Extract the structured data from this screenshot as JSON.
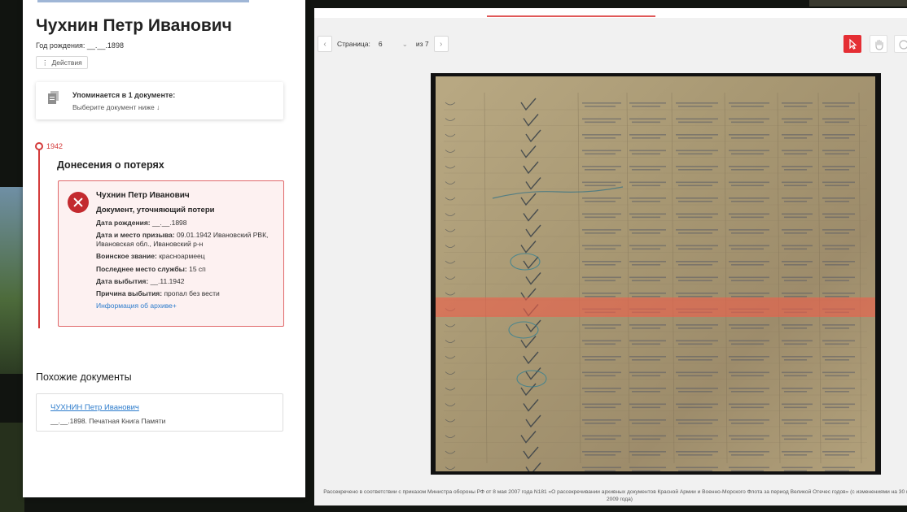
{
  "person": {
    "name": "Чухнин Петр Иванович",
    "birth_label": "Год рождения:",
    "birth_value": "__.__.1898"
  },
  "actions": {
    "label": "Действия"
  },
  "mentions": {
    "title": "Упоминается в 1 документе:",
    "subtitle": "Выберите документ ниже ↓"
  },
  "timeline": {
    "year": "1942",
    "section_title": "Донесения о потерях"
  },
  "loss_card": {
    "name": "Чухнин Петр Иванович",
    "doc_type": "Документ, уточняющий потери",
    "rows": [
      {
        "label": "Дата рождения:",
        "value": " __.__.1898"
      },
      {
        "label": "Дата и место призыва:",
        "value": " 09.01.1942 Ивановский РВК, Ивановская обл., Ивановский р-н"
      },
      {
        "label": "Воинское звание:",
        "value": " красноармеец"
      },
      {
        "label": "Последнее место службы:",
        "value": " 15 сп"
      },
      {
        "label": "Дата выбытия:",
        "value": " __.11.1942"
      },
      {
        "label": "Причина выбытия:",
        "value": " пропал без вести"
      }
    ],
    "archive_link": "Информация об архиве+"
  },
  "similar": {
    "title": "Похожие документы",
    "link": "ЧУХНИН Петр Иванович",
    "subtitle": "__.__.1898. Печатная Книга Памяти"
  },
  "viewer": {
    "page_label": "Страница:",
    "page_value": "6",
    "of_label": "из 7",
    "prev_icon": "chevron-left-icon",
    "next_icon": "chevron-right-icon",
    "footnote": "Рассекречено в соответствии с приказом Министра обороны РФ от 8 мая 2007 года N181 «О рассекречивании архивных документов Красной Армии и Военно-Морского Флота за период Великой Отечес годов» (с изменениями на 30 мая 2009 года)"
  },
  "colors": {
    "accent_red": "#e52e34",
    "timeline_red": "#d43b3b",
    "link_blue": "#2d7ccc",
    "highlight": "#ee5f4b"
  }
}
